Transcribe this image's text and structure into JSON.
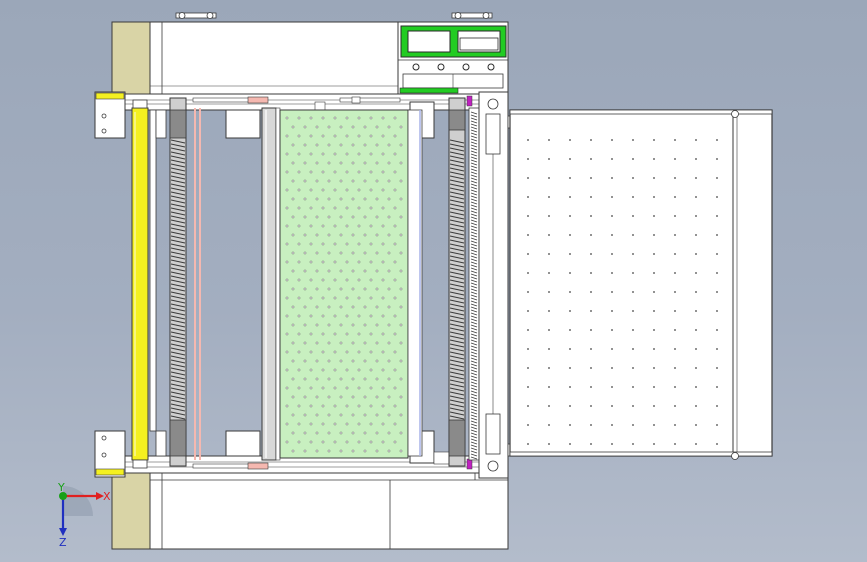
{
  "viewport": {
    "triad": {
      "x_label": "X",
      "y_label": "Y",
      "z_label": "Z",
      "x_color": "#e02020",
      "y_color": "#18a018",
      "z_color": "#2030c0"
    }
  },
  "model": {
    "colors": {
      "frame_fill": "#ffffff",
      "frame_stroke": "#3a3a3a",
      "side_plate": "#d9d4a6",
      "yellow_roller": "#f4f020",
      "green_panel": "#c8f0c0",
      "display_bezel": "#22cc22",
      "pink_rod": "#f5b8b0",
      "gray_roller": "#d8d8d8",
      "purple_mark": "#c020c0"
    },
    "icons": [
      "coordinate-triad-icon",
      "bolt-icon",
      "display-icon",
      "knob-icon"
    ]
  }
}
